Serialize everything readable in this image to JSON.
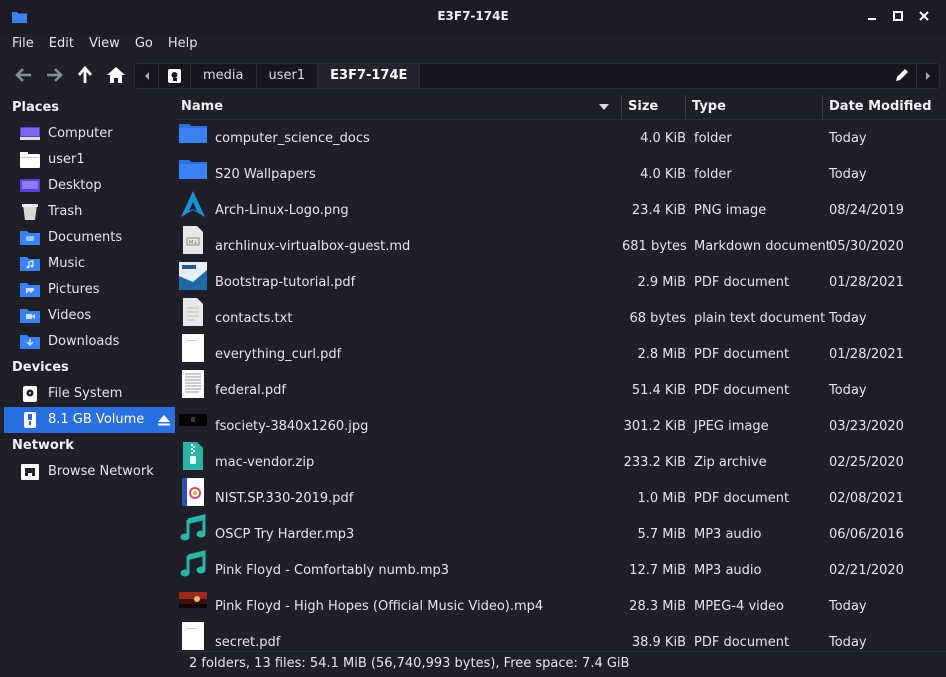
{
  "window": {
    "title": "E3F7-174E"
  },
  "menu": [
    "File",
    "Edit",
    "View",
    "Go",
    "Help"
  ],
  "path": {
    "segments": [
      "media",
      "user1",
      "E3F7-174E"
    ]
  },
  "sidebar": {
    "places_label": "Places",
    "places": [
      {
        "label": "Computer",
        "icon": "computer-icon"
      },
      {
        "label": "user1",
        "icon": "home-folder-icon"
      },
      {
        "label": "Desktop",
        "icon": "desktop-folder-icon"
      },
      {
        "label": "Trash",
        "icon": "trash-icon"
      },
      {
        "label": "Documents",
        "icon": "documents-folder-icon"
      },
      {
        "label": "Music",
        "icon": "music-folder-icon"
      },
      {
        "label": "Pictures",
        "icon": "pictures-folder-icon"
      },
      {
        "label": "Videos",
        "icon": "videos-folder-icon"
      },
      {
        "label": "Downloads",
        "icon": "downloads-folder-icon"
      }
    ],
    "devices_label": "Devices",
    "devices": [
      {
        "label": "File System",
        "icon": "drive-icon"
      },
      {
        "label": "8.1 GB Volume",
        "icon": "usb-drive-icon",
        "selected": true
      }
    ],
    "network_label": "Network",
    "network": [
      {
        "label": "Browse Network",
        "icon": "network-icon"
      }
    ]
  },
  "columns": {
    "name": "Name",
    "size": "Size",
    "type": "Type",
    "date": "Date Modified"
  },
  "files": [
    {
      "name": "computer_science_docs",
      "size": "4.0 KiB",
      "type": "folder",
      "date": "Today",
      "icon": "folder"
    },
    {
      "name": "S20 Wallpapers",
      "size": "4.0 KiB",
      "type": "folder",
      "date": "Today",
      "icon": "folder"
    },
    {
      "name": "Arch-Linux-Logo.png",
      "size": "23.4 KiB",
      "type": "PNG image",
      "date": "08/24/2019",
      "icon": "arch"
    },
    {
      "name": "archlinux-virtualbox-guest.md",
      "size": "681 bytes",
      "type": "Markdown document",
      "date": "05/30/2020",
      "icon": "md"
    },
    {
      "name": "Bootstrap-tutorial.pdf",
      "size": "2.9 MiB",
      "type": "PDF document",
      "date": "01/28/2021",
      "icon": "pdfblue"
    },
    {
      "name": "contacts.txt",
      "size": "68 bytes",
      "type": "plain text document",
      "date": "Today",
      "icon": "txt"
    },
    {
      "name": "everything_curl.pdf",
      "size": "2.8 MiB",
      "type": "PDF document",
      "date": "01/28/2021",
      "icon": "pdfwhite"
    },
    {
      "name": "federal.pdf",
      "size": "51.4 KiB",
      "type": "PDF document",
      "date": "Today",
      "icon": "pdftext"
    },
    {
      "name": "fsociety-3840x1260.jpg",
      "size": "301.2 KiB",
      "type": "JPEG image",
      "date": "03/23/2020",
      "icon": "jpgdark"
    },
    {
      "name": "mac-vendor.zip",
      "size": "233.2 KiB",
      "type": "Zip archive",
      "date": "02/25/2020",
      "icon": "zip"
    },
    {
      "name": "NIST.SP.330-2019.pdf",
      "size": "1.0 MiB",
      "type": "PDF document",
      "date": "02/08/2021",
      "icon": "pdfnist"
    },
    {
      "name": "OSCP Try Harder.mp3",
      "size": "5.7 MiB",
      "type": "MP3 audio",
      "date": "06/06/2016",
      "icon": "mp3"
    },
    {
      "name": "Pink Floyd - Comfortably numb.mp3",
      "size": "12.7 MiB",
      "type": "MP3 audio",
      "date": "02/21/2020",
      "icon": "mp3"
    },
    {
      "name": "Pink Floyd - High Hopes (Official Music Video).mp4",
      "size": "28.3 MiB",
      "type": "MPEG-4 video",
      "date": "Today",
      "icon": "mp4"
    },
    {
      "name": "secret.pdf",
      "size": "38.9 KiB",
      "type": "PDF document",
      "date": "Today",
      "icon": "pdfwhite"
    }
  ],
  "status": "2 folders, 13 files: 54.1 MiB (56,740,993 bytes), Free space: 7.4 GiB",
  "colors": {
    "accent": "#2a6fe0",
    "folder": "#3b82f6",
    "background": "#1e1f29",
    "teal": "#2bb5a7"
  }
}
